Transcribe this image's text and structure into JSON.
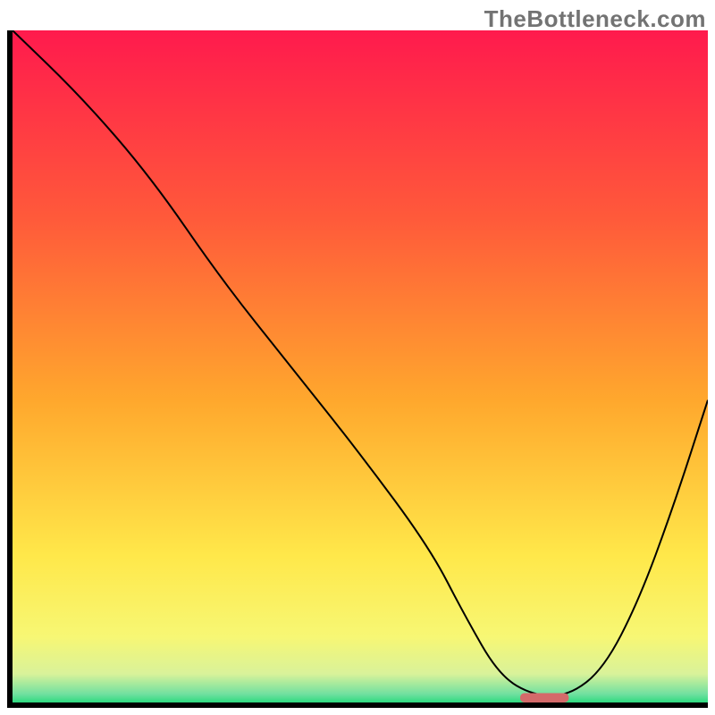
{
  "watermark": "TheBottleneck.com",
  "chart_data": {
    "type": "line",
    "title": "",
    "xlabel": "",
    "ylabel": "",
    "xlim": [
      0,
      100
    ],
    "ylim": [
      0,
      100
    ],
    "grid": false,
    "series": [
      {
        "name": "bottleneck-curve",
        "x": [
          0,
          10,
          20,
          30,
          40,
          50,
          60,
          65,
          70,
          75,
          80,
          85,
          90,
          95,
          100
        ],
        "y": [
          100,
          90,
          78,
          63,
          50,
          37,
          23,
          13,
          4,
          1,
          1,
          5,
          15,
          29,
          45
        ],
        "stroke": "#000000",
        "stroke_width": 2
      }
    ],
    "optimum_marker": {
      "x_start": 73,
      "x_end": 80,
      "y": 0.5,
      "color": "#d46a6a",
      "height_pct": 1.4
    },
    "background_gradient": {
      "type": "vertical",
      "stops": [
        {
          "offset": 0.0,
          "color": "#ff1a4d"
        },
        {
          "offset": 0.28,
          "color": "#ff5a3a"
        },
        {
          "offset": 0.55,
          "color": "#ffa82d"
        },
        {
          "offset": 0.78,
          "color": "#ffe84a"
        },
        {
          "offset": 0.9,
          "color": "#f7f774"
        },
        {
          "offset": 0.955,
          "color": "#d9f29a"
        },
        {
          "offset": 0.985,
          "color": "#70e0a0"
        },
        {
          "offset": 1.0,
          "color": "#1fd978"
        }
      ]
    },
    "axes": {
      "color": "#000000",
      "width": 6
    }
  }
}
